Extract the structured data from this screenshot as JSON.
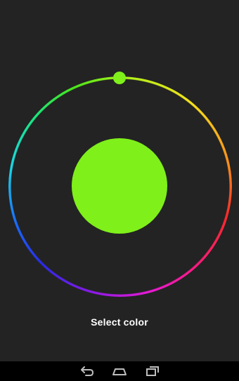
{
  "picker": {
    "selected_color": "#7ff01a",
    "previous_color": "#7ff01a",
    "handle_color": "#7ff01a",
    "select_label": "Select color"
  },
  "navbar": {
    "background": "#000000",
    "icon_color": "#bdbdbd",
    "buttons": [
      {
        "icon": "back-icon"
      },
      {
        "icon": "home-icon"
      },
      {
        "icon": "recent-apps-icon"
      }
    ]
  }
}
